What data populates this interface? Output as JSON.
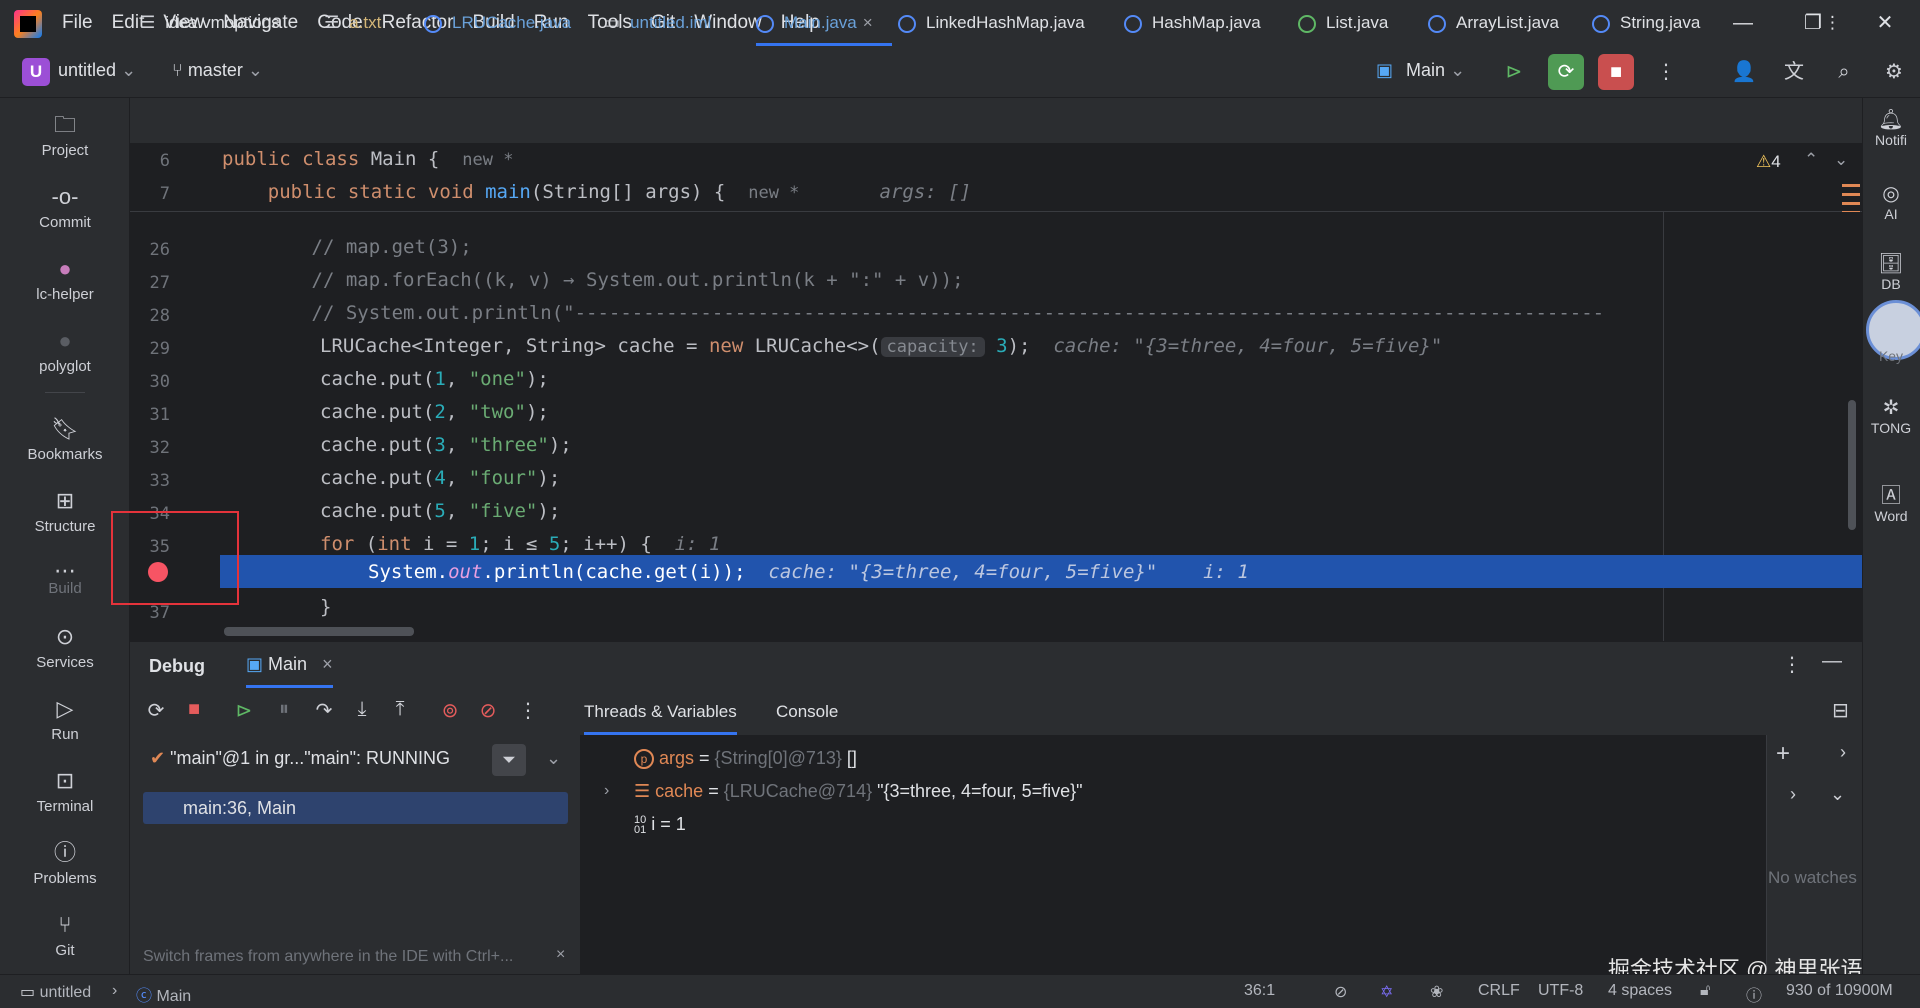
{
  "menu": [
    "File",
    "Edit",
    "View",
    "Navigate",
    "Code",
    "Refactor",
    "Build",
    "Run",
    "Tools",
    "Git",
    "Window",
    "Help"
  ],
  "toolbar": {
    "project_badge": "U",
    "project_name": "untitled",
    "branch": "master",
    "run_config": "Main"
  },
  "left_tools": [
    "Project",
    "Commit",
    "lc-helper",
    "polyglot",
    "Bookmarks",
    "Structure",
    "Build",
    "Services",
    "Run",
    "Terminal",
    "Problems",
    "Git"
  ],
  "right_tools": [
    "Notifi",
    "AI",
    "DB",
    "Key",
    "TONG",
    "Word"
  ],
  "tabs": [
    {
      "label": "idea.vmoptions",
      "icon": "lines-icon"
    },
    {
      "label": "a.txt",
      "icon": "lines-icon"
    },
    {
      "label": "LRUCache.java",
      "icon": "class-icon"
    },
    {
      "label": "untitled.iml",
      "icon": "module-icon"
    },
    {
      "label": "Main.java",
      "icon": "class-icon",
      "active": true
    },
    {
      "label": "LinkedHashMap.java",
      "icon": "class-icon"
    },
    {
      "label": "HashMap.java",
      "icon": "class-icon"
    },
    {
      "label": "List.java",
      "icon": "interface-icon"
    },
    {
      "label": "ArrayList.java",
      "icon": "class-icon"
    },
    {
      "label": "String.java",
      "icon": "class-icon"
    }
  ],
  "editor": {
    "warnings_count": "4",
    "sticky": [
      {
        "line": "6",
        "pre": "public class ",
        "name": "Main",
        "post": " {",
        "hint": "new *"
      },
      {
        "line": "7",
        "pre": "    public static void ",
        "name": "main",
        "post": "(String[] args) {",
        "hint": "new *",
        "hint2": "args: []"
      }
    ],
    "lines": [
      {
        "n": "26",
        "text": "        // map.get(3);"
      },
      {
        "n": "27",
        "text": "        // map.forEach((k, v) → System.out.println(k + \":\" + v));"
      },
      {
        "n": "28",
        "text": "        // System.out.println(\"------------------------------------------------------------------------------------------"
      },
      {
        "n": "29",
        "text": "LRUCache<Integer, String> cache = new LRUCache<>("
      },
      {
        "n": "30",
        "text": "cache.put(1, \"one\");"
      },
      {
        "n": "31",
        "text": "cache.put(2, \"two\");"
      },
      {
        "n": "32",
        "text": "cache.put(3, \"three\");"
      },
      {
        "n": "33",
        "text": "cache.put(4, \"four\");"
      },
      {
        "n": "34",
        "text": "cache.put(5, \"five\");"
      },
      {
        "n": "35",
        "text": "for (int i = 1; i ≤ 5; i++) {"
      },
      {
        "n": "36",
        "text": "System.out.println(cache.get(i));"
      },
      {
        "n": "37",
        "text": "}"
      }
    ],
    "param_hint": "capacity:",
    "cache_hint": "cache: \"{3=three, 4=four, 5=five}\"",
    "i_hint_35": "i: 1",
    "i_hint_36": "i: 1"
  },
  "debug": {
    "title": "Debug",
    "session_tab": "Main",
    "subtabs": [
      "Threads & Variables",
      "Console"
    ],
    "thread": "\"main\"@1 in gr...\"main\": RUNNING",
    "frame": "main:36, Main",
    "hint": "Switch frames from anywhere in the IDE with Ctrl+...",
    "variables": [
      {
        "name": "args",
        "eq": " = ",
        "ref": "{String[0]@713}",
        "value": " []",
        "icon": "p"
      },
      {
        "name": "cache",
        "eq": " = ",
        "ref": "{LRUCache@714}",
        "value": " \"{3=three, 4=four, 5=five}\"",
        "icon": "field"
      },
      {
        "name": "i",
        "eq": " = ",
        "ref": "",
        "value": "1",
        "icon": "10/01"
      }
    ],
    "watches_empty": "No watches"
  },
  "status": {
    "project": "untitled",
    "file": "Main",
    "position": "36:1",
    "line_sep": "CRLF",
    "encoding": "UTF-8",
    "indent": "4 spaces",
    "memory": "930 of 10900M"
  },
  "watermark": "掘金技术社区 @ 神里张语"
}
